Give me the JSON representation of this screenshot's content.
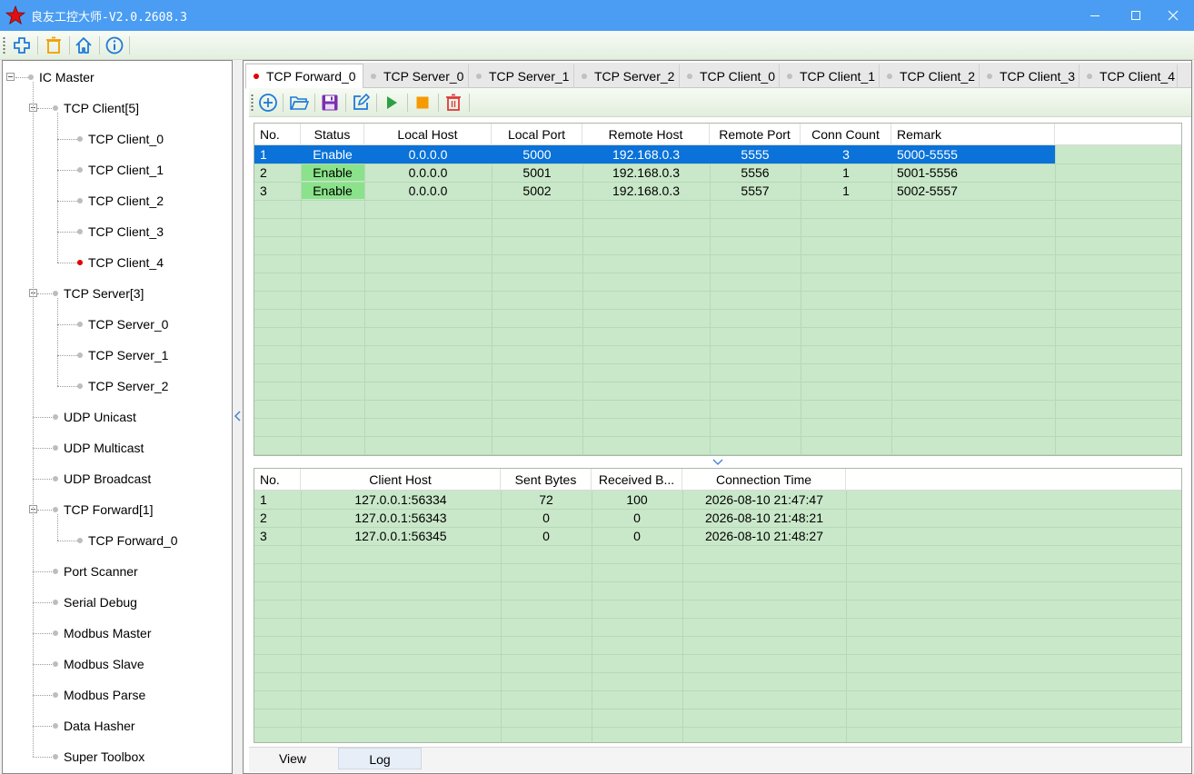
{
  "window": {
    "title": "良友工控大师-V2.0.2608.3",
    "controls": [
      "minimize-icon",
      "maximize-icon",
      "close-icon"
    ]
  },
  "toolbar": {
    "buttons": [
      "add-icon",
      "delete-icon",
      "home-icon",
      "info-icon"
    ]
  },
  "tree": {
    "root": "IC Master",
    "items": [
      {
        "label": "TCP Client[5]",
        "level": 1,
        "expander": true
      },
      {
        "label": "TCP Client_0",
        "level": 2
      },
      {
        "label": "TCP Client_1",
        "level": 2
      },
      {
        "label": "TCP Client_2",
        "level": 2
      },
      {
        "label": "TCP Client_3",
        "level": 2
      },
      {
        "label": "TCP Client_4",
        "level": 2,
        "active": true
      },
      {
        "label": "TCP Server[3]",
        "level": 1,
        "expander": true
      },
      {
        "label": "TCP Server_0",
        "level": 2
      },
      {
        "label": "TCP Server_1",
        "level": 2
      },
      {
        "label": "TCP Server_2",
        "level": 2
      },
      {
        "label": "UDP Unicast",
        "level": 1
      },
      {
        "label": "UDP Multicast",
        "level": 1
      },
      {
        "label": "UDP Broadcast",
        "level": 1
      },
      {
        "label": "TCP Forward[1]",
        "level": 1,
        "expander": true
      },
      {
        "label": "TCP Forward_0",
        "level": 2
      },
      {
        "label": "Port Scanner",
        "level": 1
      },
      {
        "label": "Serial Debug",
        "level": 1
      },
      {
        "label": "Modbus Master",
        "level": 1
      },
      {
        "label": "Modbus Slave",
        "level": 1
      },
      {
        "label": "Modbus Parse",
        "level": 1
      },
      {
        "label": "Data Hasher",
        "level": 1
      },
      {
        "label": "Super Toolbox",
        "level": 1
      }
    ]
  },
  "tabs": [
    {
      "label": "TCP Forward_0",
      "active": true
    },
    {
      "label": "TCP Server_0"
    },
    {
      "label": "TCP Server_1"
    },
    {
      "label": "TCP Server_2"
    },
    {
      "label": "TCP Client_0"
    },
    {
      "label": "TCP Client_1"
    },
    {
      "label": "TCP Client_2"
    },
    {
      "label": "TCP Client_3"
    },
    {
      "label": "TCP Client_4"
    }
  ],
  "sub_toolbar": {
    "buttons": [
      "add-circle-icon",
      "open-folder-icon",
      "save-icon",
      "edit-icon",
      "play-icon",
      "stop-icon",
      "delete-icon"
    ]
  },
  "forward_table": {
    "columns": [
      "No.",
      "Status",
      "Local Host",
      "Local Port",
      "Remote Host",
      "Remote Port",
      "Conn Count",
      "Remark"
    ],
    "rows": [
      {
        "no": "1",
        "status": "Enable",
        "local_host": "0.0.0.0",
        "local_port": "5000",
        "remote_host": "192.168.0.3",
        "remote_port": "5555",
        "conn_count": "3",
        "remark": "5000-5555",
        "selected": true
      },
      {
        "no": "2",
        "status": "Enable",
        "local_host": "0.0.0.0",
        "local_port": "5001",
        "remote_host": "192.168.0.3",
        "remote_port": "5556",
        "conn_count": "1",
        "remark": "5001-5556"
      },
      {
        "no": "3",
        "status": "Enable",
        "local_host": "0.0.0.0",
        "local_port": "5002",
        "remote_host": "192.168.0.3",
        "remote_port": "5557",
        "conn_count": "1",
        "remark": "5002-5557"
      }
    ]
  },
  "connections_table": {
    "columns": [
      "No.",
      "Client Host",
      "Sent Bytes",
      "Received B...",
      "Connection Time"
    ],
    "rows": [
      {
        "no": "1",
        "client_host": "127.0.0.1:56334",
        "sent": "72",
        "received": "100",
        "time": "2026-08-10 21:47:47"
      },
      {
        "no": "2",
        "client_host": "127.0.0.1:56343",
        "sent": "0",
        "received": "0",
        "time": "2026-08-10 21:48:21"
      },
      {
        "no": "3",
        "client_host": "127.0.0.1:56345",
        "sent": "0",
        "received": "0",
        "time": "2026-08-10 21:48:27"
      }
    ]
  },
  "bottom_tabs": [
    {
      "label": "View"
    },
    {
      "label": "Log",
      "active": true
    }
  ],
  "colors": {
    "titlebar": "#4a9df2",
    "grid_bg": "#c9e7c9",
    "selection": "#0a72d8",
    "status_enable": "#8ae28a",
    "active_dot": "#e00000"
  }
}
